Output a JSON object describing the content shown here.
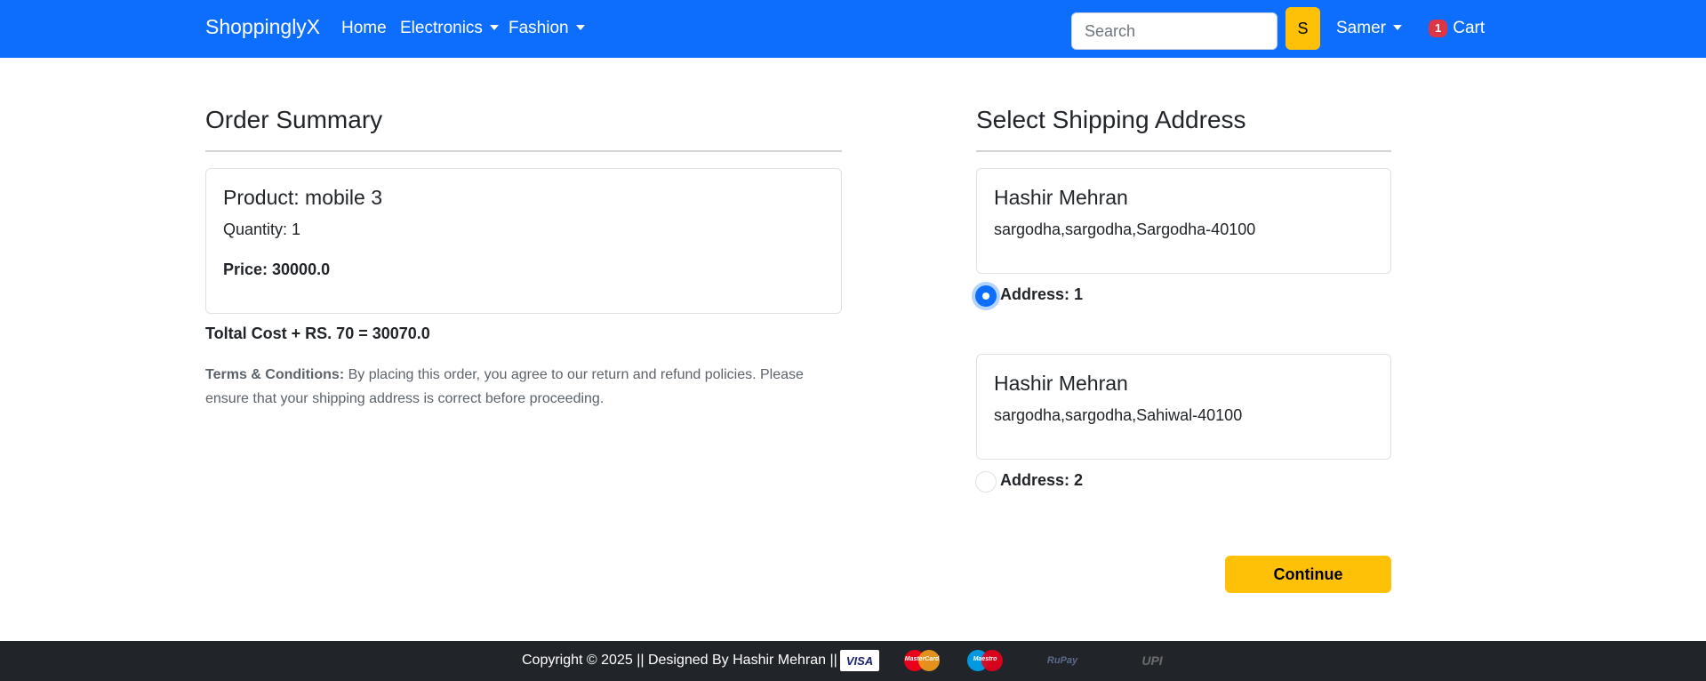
{
  "navbar": {
    "brand": "ShoppinglyX",
    "links": [
      "Home",
      "Electronics",
      "Fashion"
    ],
    "search_placeholder": "Search",
    "search_button": "S",
    "user": "Samer",
    "cart_count": "1",
    "cart_label": "Cart",
    "accent_color": "#0d6efd"
  },
  "order": {
    "heading": "Order Summary",
    "product": "Product: mobile 3",
    "quantity": "Quantity: 1",
    "price": "Price: 30000.0",
    "total": "Toltal Cost + RS. 70 = 30070.0",
    "terms_label": "Terms & Conditions:",
    "terms_text": " By placing this order, you agree to our return and refund policies. Please ensure that your shipping address is correct before proceeding."
  },
  "shipping": {
    "heading": "Select Shipping Address",
    "addresses": [
      {
        "name": "Hashir Mehran",
        "address": "sargodha,sargodha,Sargodha-40100",
        "label": "Address: 1",
        "selected": true
      },
      {
        "name": "Hashir Mehran",
        "address": "sargodha,sargodha,Sahiwal-40100",
        "label": "Address: 2",
        "selected": false
      }
    ],
    "continue_label": "Continue",
    "button_color": "#ffc107"
  },
  "footer": {
    "copyright": "Copyright © 2025 || Designed By Hashir Mehran ||",
    "payment_icons": [
      "visa-icon",
      "mastercard-icon",
      "maestro-icon",
      "rupay-icon",
      "upi-icon"
    ],
    "payment_labels": {
      "visa": "VISA",
      "mastercard": "MasterCard",
      "maestro": "Maestro",
      "rupay": "RuPay",
      "upi": "UPI"
    }
  }
}
